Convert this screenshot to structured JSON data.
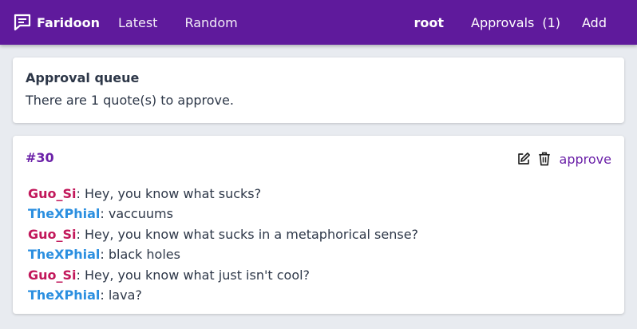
{
  "navbar": {
    "brand": "Faridoon",
    "links": [
      "Latest",
      "Random"
    ],
    "user": "root",
    "approvals_label": "Approvals",
    "approvals_count": "(1)",
    "add_label": "Add"
  },
  "queue": {
    "title": "Approval queue",
    "text": "There are 1 quote(s) to approve."
  },
  "quote": {
    "id": "#30",
    "approve_label": "approve",
    "lines": [
      {
        "nick": "Guo_Si",
        "color": "#c2185b",
        "text": ": Hey, you know what sucks?"
      },
      {
        "nick": "TheXPhial",
        "color": "#2b8fe0",
        "text": ": vaccuums"
      },
      {
        "nick": "Guo_Si",
        "color": "#c2185b",
        "text": ": Hey, you know what sucks in a metaphorical sense?"
      },
      {
        "nick": "TheXPhial",
        "color": "#2b8fe0",
        "text": ": black holes"
      },
      {
        "nick": "Guo_Si",
        "color": "#c2185b",
        "text": ": Hey, you know what just isn't cool?"
      },
      {
        "nick": "TheXPhial",
        "color": "#2b8fe0",
        "text": ": lava?"
      }
    ]
  },
  "colors": {
    "navbar": "#5f1a9c",
    "accent": "#6b21a8",
    "background": "#e8ebf0"
  },
  "icons": {
    "brand": "speech-bubble-icon",
    "edit": "edit-icon",
    "delete": "trash-icon"
  }
}
